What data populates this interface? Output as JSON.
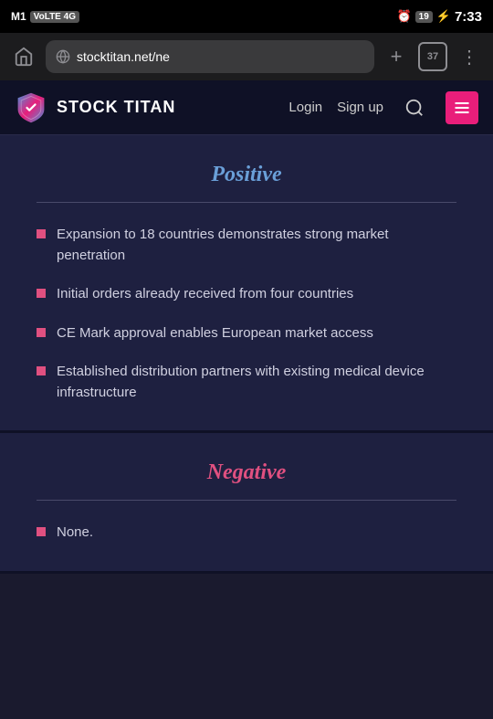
{
  "statusBar": {
    "carrier": "M1",
    "networkType": "VoLTE 4G",
    "alarmIcon": "alarm-icon",
    "batteryLevel": "19",
    "time": "7:33"
  },
  "browserBar": {
    "url": "stocktitan.net/ne",
    "tabCount": "37",
    "homeLabel": "⌂",
    "addLabel": "+",
    "moreLabel": "⋮"
  },
  "siteHeader": {
    "logoText": "STOCK TITAN",
    "loginLabel": "Login",
    "signupLabel": "Sign up"
  },
  "positive": {
    "title": "Positive",
    "bullets": [
      "Expansion to 18 countries demonstrates strong market penetration",
      "Initial orders already received from four countries",
      "CE Mark approval enables European market access",
      "Established distribution partners with existing medical device infrastructure"
    ]
  },
  "negative": {
    "title": "Negative",
    "bullets": [
      "None."
    ]
  }
}
